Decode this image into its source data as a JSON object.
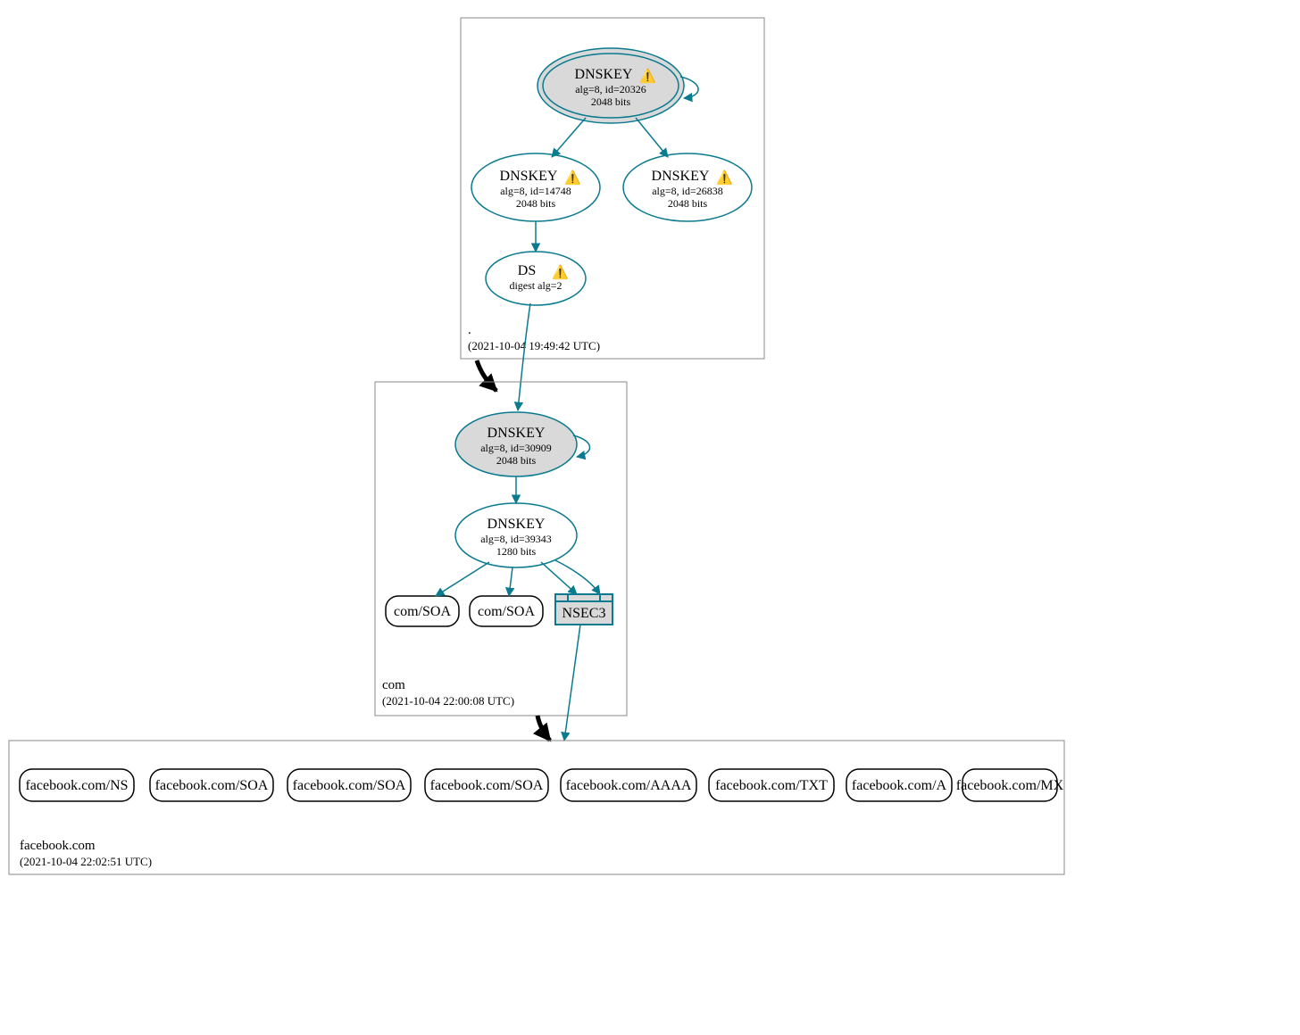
{
  "zones": {
    "root": {
      "name": ".",
      "time": "(2021-10-04 19:49:42 UTC)"
    },
    "com": {
      "name": "com",
      "time": "(2021-10-04 22:00:08 UTC)"
    },
    "fb": {
      "name": "facebook.com",
      "time": "(2021-10-04 22:02:51 UTC)"
    }
  },
  "nodes": {
    "root_ksk": {
      "title": "DNSKEY",
      "line2": "alg=8, id=20326",
      "line3": "2048 bits",
      "warn": true
    },
    "root_zsk1": {
      "title": "DNSKEY",
      "line2": "alg=8, id=14748",
      "line3": "2048 bits",
      "warn": true
    },
    "root_zsk2": {
      "title": "DNSKEY",
      "line2": "alg=8, id=26838",
      "line3": "2048 bits",
      "warn": true
    },
    "root_ds": {
      "title": "DS",
      "line2": "digest alg=2",
      "warn": true
    },
    "com_ksk": {
      "title": "DNSKEY",
      "line2": "alg=8, id=30909",
      "line3": "2048 bits"
    },
    "com_zsk": {
      "title": "DNSKEY",
      "line2": "alg=8, id=39343",
      "line3": "1280 bits"
    },
    "com_soa1": {
      "title": "com/SOA"
    },
    "com_soa2": {
      "title": "com/SOA"
    },
    "com_nsec3": {
      "title": "NSEC3"
    },
    "fb_ns": {
      "title": "facebook.com/NS"
    },
    "fb_soa1": {
      "title": "facebook.com/SOA"
    },
    "fb_soa2": {
      "title": "facebook.com/SOA"
    },
    "fb_soa3": {
      "title": "facebook.com/SOA"
    },
    "fb_aaaa": {
      "title": "facebook.com/AAAA"
    },
    "fb_txt": {
      "title": "facebook.com/TXT"
    },
    "fb_a": {
      "title": "facebook.com/A"
    },
    "fb_mx": {
      "title": "facebook.com/MX"
    }
  },
  "icons": {
    "warn": "⚠️"
  }
}
